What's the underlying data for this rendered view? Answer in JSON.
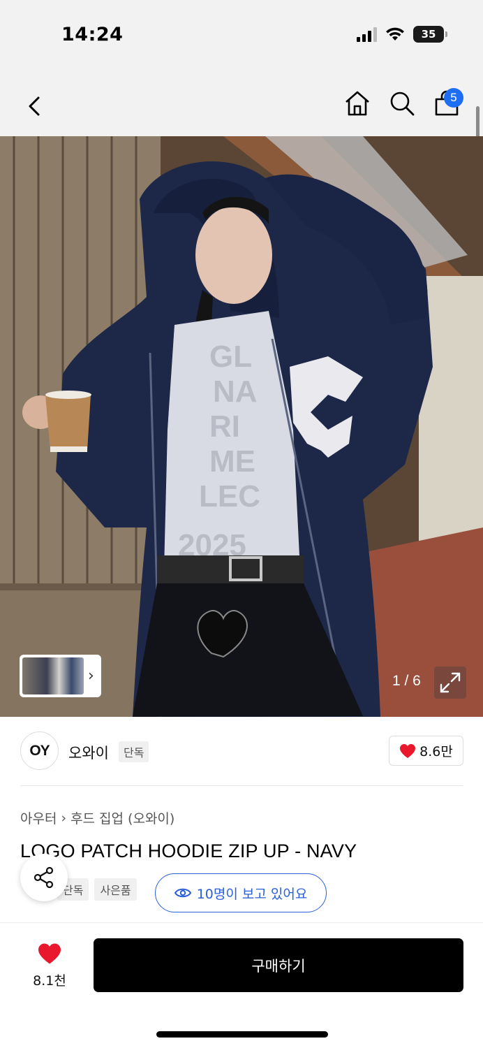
{
  "status_bar": {
    "time": "14:24",
    "battery": "35"
  },
  "nav": {
    "cart_count": "5",
    "icons": [
      "back-icon",
      "home-icon",
      "search-icon",
      "cart-icon"
    ]
  },
  "gallery": {
    "counter": "1 / 6"
  },
  "brand": {
    "logo_text": "OY",
    "name": "오와이",
    "tag": "단독",
    "likes": "8.6만"
  },
  "breadcrumb": {
    "category": "아우터",
    "subcategory": "후드 집업 (오와이)"
  },
  "product": {
    "title": "LOGO PATCH HOODIE ZIP UP - NAVY",
    "tags": [
      "단독",
      "사은품"
    ],
    "viewers": "10명이 보고 있어요"
  },
  "bottom": {
    "favorites": "8.1천",
    "buy_label": "구매하기"
  },
  "colors": {
    "accent": "#1e6ef4",
    "viewers_blue": "#2b5fd9",
    "heart": "#e8192c",
    "buy": "#000000",
    "hoodie_navy": "#1d2748"
  }
}
